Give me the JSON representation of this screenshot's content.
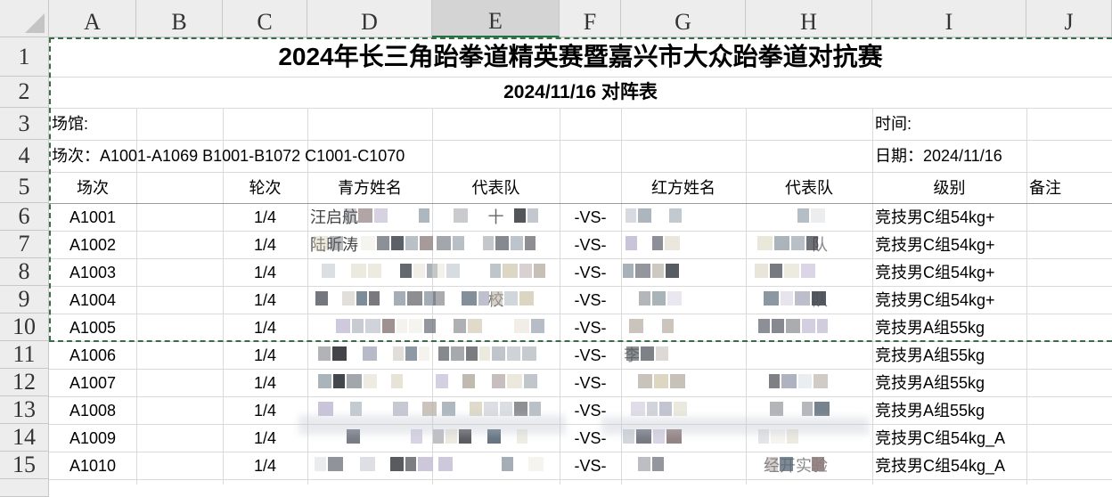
{
  "columns": [
    "A",
    "B",
    "C",
    "D",
    "E",
    "F",
    "G",
    "H",
    "I",
    "J"
  ],
  "rows": [
    "1",
    "2",
    "3",
    "4",
    "5",
    "6",
    "7",
    "8",
    "9",
    "10",
    "11",
    "12",
    "13",
    "14",
    "15"
  ],
  "title": "2024年长三角跆拳道精英赛暨嘉兴市大众跆拳道对抗赛",
  "subtitle": "2024/11/16 对阵表",
  "venue_label": "场馆:",
  "time_label": "时间:",
  "session_text": "场次：A1001-A1069 B1001-B1072 C1001-C1070",
  "date_text": "日期：2024/11/16",
  "headers": {
    "match": "场次",
    "round": "轮次",
    "blue_name": "青方姓名",
    "blue_team": "代表队",
    "red_name": "红方姓名",
    "red_team": "代表队",
    "category": "级别",
    "note": "备注"
  },
  "matches": [
    {
      "id": "A1001",
      "round": "1/4",
      "blue_name": "汪启航",
      "blue_team": "十",
      "vs": "-VS-",
      "red_name": "",
      "red_team": "",
      "category": "竞技男C组54kg+"
    },
    {
      "id": "A1002",
      "round": "1/4",
      "blue_name": "陆昕涛",
      "blue_team": "",
      "vs": "-VS-",
      "red_name": "",
      "red_team": "队",
      "category": "竞技男C组54kg+"
    },
    {
      "id": "A1003",
      "round": "1/4",
      "blue_name": "",
      "blue_team": "",
      "vs": "-VS-",
      "red_name": "",
      "red_team": "",
      "category": "竞技男C组54kg+"
    },
    {
      "id": "A1004",
      "round": "1/4",
      "blue_name": "",
      "blue_team": "校",
      "vs": "-VS-",
      "red_name": "",
      "red_team": "队",
      "category": "竞技男C组54kg+"
    },
    {
      "id": "A1005",
      "round": "1/4",
      "blue_name": "",
      "blue_team": "",
      "vs": "-VS-",
      "red_name": "",
      "red_team": "",
      "category": "竞技男A组55kg"
    },
    {
      "id": "A1006",
      "round": "1/4",
      "blue_name": "",
      "blue_team": "",
      "vs": "-VS-",
      "red_name": "李",
      "red_team": "",
      "category": "竞技男A组55kg"
    },
    {
      "id": "A1007",
      "round": "1/4",
      "blue_name": "",
      "blue_team": "",
      "vs": "-VS-",
      "red_name": "",
      "red_team": "",
      "category": "竞技男A组55kg"
    },
    {
      "id": "A1008",
      "round": "1/4",
      "blue_name": "",
      "blue_team": "",
      "vs": "-VS-",
      "red_name": "",
      "red_team": "",
      "category": "竞技男A组55kg"
    },
    {
      "id": "A1009",
      "round": "1/4",
      "blue_name": "",
      "blue_team": "",
      "vs": "-VS-",
      "red_name": "",
      "red_team": "",
      "category": "竞技男C组54kg_A"
    },
    {
      "id": "A1010",
      "round": "1/4",
      "blue_name": "",
      "blue_team": "",
      "vs": "-VS-",
      "red_name": "",
      "red_team": "经开实验",
      "category": "竞技男C组54kg_A"
    }
  ],
  "colors": {
    "header_bg": "#ededed",
    "header_selected_bg": "#d4d4d4",
    "header_selected_border": "#217346",
    "gridline": "#dadada",
    "print_area_dash": "#3a6b4a"
  }
}
